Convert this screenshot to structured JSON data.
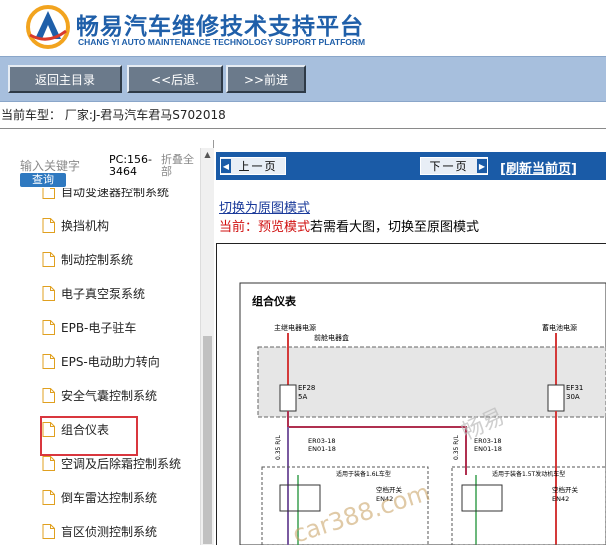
{
  "header": {
    "title_cn": "畅易汽车维修技术支持平台",
    "title_en": "CHANG YI AUTO MAINTENANCE TECHNOLOGY SUPPORT PLATFORM",
    "brand_color": "#1f5fa9"
  },
  "toolbar": {
    "home_label": "返回主目录",
    "back_label": "<<后退.",
    "forward_label": ">>前进"
  },
  "current_model": "当前车型： 厂家:J-君马汽车君马S702018",
  "sidebar": {
    "search_placeholder": "输入关键字",
    "search_button": "查询",
    "pc_code": "PC:156-3464",
    "fold_all": "折叠全部",
    "items": [
      {
        "label": "自动变速器控制系统"
      },
      {
        "label": "换挡机构"
      },
      {
        "label": "制动控制系统"
      },
      {
        "label": "电子真空泵系统"
      },
      {
        "label": "EPB-电子驻车"
      },
      {
        "label": "EPS-电动助力转向"
      },
      {
        "label": "安全气囊控制系统"
      },
      {
        "label": "组合仪表"
      },
      {
        "label": "空调及后除霜控制系统"
      },
      {
        "label": "倒车雷达控制系统"
      },
      {
        "label": "盲区侦测控制系统"
      }
    ],
    "selected_index": 7
  },
  "content": {
    "prev_label": "上一页",
    "next_label": "下一页",
    "refresh_label": "[刷新当前页]",
    "switch_link": "切换为原图模式",
    "mode_prefix": "当前：",
    "mode_name": "预览模式",
    "mode_suffix": "若需看大图，切换至原图模式"
  },
  "diagram": {
    "title": "组合仪表",
    "label_main_power": "主继电器电源",
    "label_cab_box": "前舱电器盒",
    "label_battery": "蓄电池电源",
    "fuse1_name": "EF28",
    "fuse1_rating": "5A",
    "fuse2_name": "EF31",
    "fuse2_rating": "30A",
    "wire1": "0.35 R/L",
    "wire2": "0.35 R/L",
    "conn1_a": "ER03-18",
    "conn1_b": "EN01-18",
    "conn2_a": "ER03-18",
    "conn2_b": "EN01-18",
    "note1": "适用于装备1.6L车型",
    "note2": "适用于装备1.5T发动机车型",
    "switch1": "空档开关",
    "switch1_code": "EN42",
    "switch2": "空档开关",
    "switch2_code": "EN42",
    "watermark": "畅易",
    "watermark2": "car388.com"
  }
}
